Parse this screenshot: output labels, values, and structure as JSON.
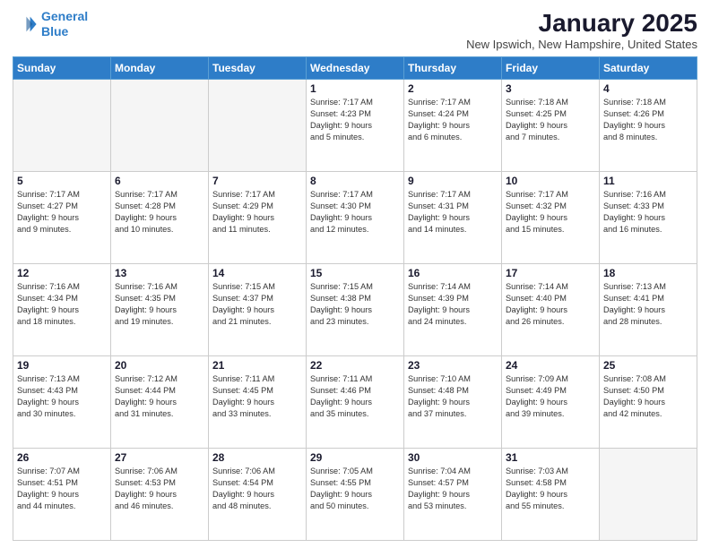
{
  "header": {
    "logo_line1": "General",
    "logo_line2": "Blue",
    "month": "January 2025",
    "location": "New Ipswich, New Hampshire, United States"
  },
  "days_of_week": [
    "Sunday",
    "Monday",
    "Tuesday",
    "Wednesday",
    "Thursday",
    "Friday",
    "Saturday"
  ],
  "weeks": [
    [
      {
        "day": "",
        "content": ""
      },
      {
        "day": "",
        "content": ""
      },
      {
        "day": "",
        "content": ""
      },
      {
        "day": "1",
        "content": "Sunrise: 7:17 AM\nSunset: 4:23 PM\nDaylight: 9 hours\nand 5 minutes."
      },
      {
        "day": "2",
        "content": "Sunrise: 7:17 AM\nSunset: 4:24 PM\nDaylight: 9 hours\nand 6 minutes."
      },
      {
        "day": "3",
        "content": "Sunrise: 7:18 AM\nSunset: 4:25 PM\nDaylight: 9 hours\nand 7 minutes."
      },
      {
        "day": "4",
        "content": "Sunrise: 7:18 AM\nSunset: 4:26 PM\nDaylight: 9 hours\nand 8 minutes."
      }
    ],
    [
      {
        "day": "5",
        "content": "Sunrise: 7:17 AM\nSunset: 4:27 PM\nDaylight: 9 hours\nand 9 minutes."
      },
      {
        "day": "6",
        "content": "Sunrise: 7:17 AM\nSunset: 4:28 PM\nDaylight: 9 hours\nand 10 minutes."
      },
      {
        "day": "7",
        "content": "Sunrise: 7:17 AM\nSunset: 4:29 PM\nDaylight: 9 hours\nand 11 minutes."
      },
      {
        "day": "8",
        "content": "Sunrise: 7:17 AM\nSunset: 4:30 PM\nDaylight: 9 hours\nand 12 minutes."
      },
      {
        "day": "9",
        "content": "Sunrise: 7:17 AM\nSunset: 4:31 PM\nDaylight: 9 hours\nand 14 minutes."
      },
      {
        "day": "10",
        "content": "Sunrise: 7:17 AM\nSunset: 4:32 PM\nDaylight: 9 hours\nand 15 minutes."
      },
      {
        "day": "11",
        "content": "Sunrise: 7:16 AM\nSunset: 4:33 PM\nDaylight: 9 hours\nand 16 minutes."
      }
    ],
    [
      {
        "day": "12",
        "content": "Sunrise: 7:16 AM\nSunset: 4:34 PM\nDaylight: 9 hours\nand 18 minutes."
      },
      {
        "day": "13",
        "content": "Sunrise: 7:16 AM\nSunset: 4:35 PM\nDaylight: 9 hours\nand 19 minutes."
      },
      {
        "day": "14",
        "content": "Sunrise: 7:15 AM\nSunset: 4:37 PM\nDaylight: 9 hours\nand 21 minutes."
      },
      {
        "day": "15",
        "content": "Sunrise: 7:15 AM\nSunset: 4:38 PM\nDaylight: 9 hours\nand 23 minutes."
      },
      {
        "day": "16",
        "content": "Sunrise: 7:14 AM\nSunset: 4:39 PM\nDaylight: 9 hours\nand 24 minutes."
      },
      {
        "day": "17",
        "content": "Sunrise: 7:14 AM\nSunset: 4:40 PM\nDaylight: 9 hours\nand 26 minutes."
      },
      {
        "day": "18",
        "content": "Sunrise: 7:13 AM\nSunset: 4:41 PM\nDaylight: 9 hours\nand 28 minutes."
      }
    ],
    [
      {
        "day": "19",
        "content": "Sunrise: 7:13 AM\nSunset: 4:43 PM\nDaylight: 9 hours\nand 30 minutes."
      },
      {
        "day": "20",
        "content": "Sunrise: 7:12 AM\nSunset: 4:44 PM\nDaylight: 9 hours\nand 31 minutes."
      },
      {
        "day": "21",
        "content": "Sunrise: 7:11 AM\nSunset: 4:45 PM\nDaylight: 9 hours\nand 33 minutes."
      },
      {
        "day": "22",
        "content": "Sunrise: 7:11 AM\nSunset: 4:46 PM\nDaylight: 9 hours\nand 35 minutes."
      },
      {
        "day": "23",
        "content": "Sunrise: 7:10 AM\nSunset: 4:48 PM\nDaylight: 9 hours\nand 37 minutes."
      },
      {
        "day": "24",
        "content": "Sunrise: 7:09 AM\nSunset: 4:49 PM\nDaylight: 9 hours\nand 39 minutes."
      },
      {
        "day": "25",
        "content": "Sunrise: 7:08 AM\nSunset: 4:50 PM\nDaylight: 9 hours\nand 42 minutes."
      }
    ],
    [
      {
        "day": "26",
        "content": "Sunrise: 7:07 AM\nSunset: 4:51 PM\nDaylight: 9 hours\nand 44 minutes."
      },
      {
        "day": "27",
        "content": "Sunrise: 7:06 AM\nSunset: 4:53 PM\nDaylight: 9 hours\nand 46 minutes."
      },
      {
        "day": "28",
        "content": "Sunrise: 7:06 AM\nSunset: 4:54 PM\nDaylight: 9 hours\nand 48 minutes."
      },
      {
        "day": "29",
        "content": "Sunrise: 7:05 AM\nSunset: 4:55 PM\nDaylight: 9 hours\nand 50 minutes."
      },
      {
        "day": "30",
        "content": "Sunrise: 7:04 AM\nSunset: 4:57 PM\nDaylight: 9 hours\nand 53 minutes."
      },
      {
        "day": "31",
        "content": "Sunrise: 7:03 AM\nSunset: 4:58 PM\nDaylight: 9 hours\nand 55 minutes."
      },
      {
        "day": "",
        "content": ""
      }
    ]
  ]
}
